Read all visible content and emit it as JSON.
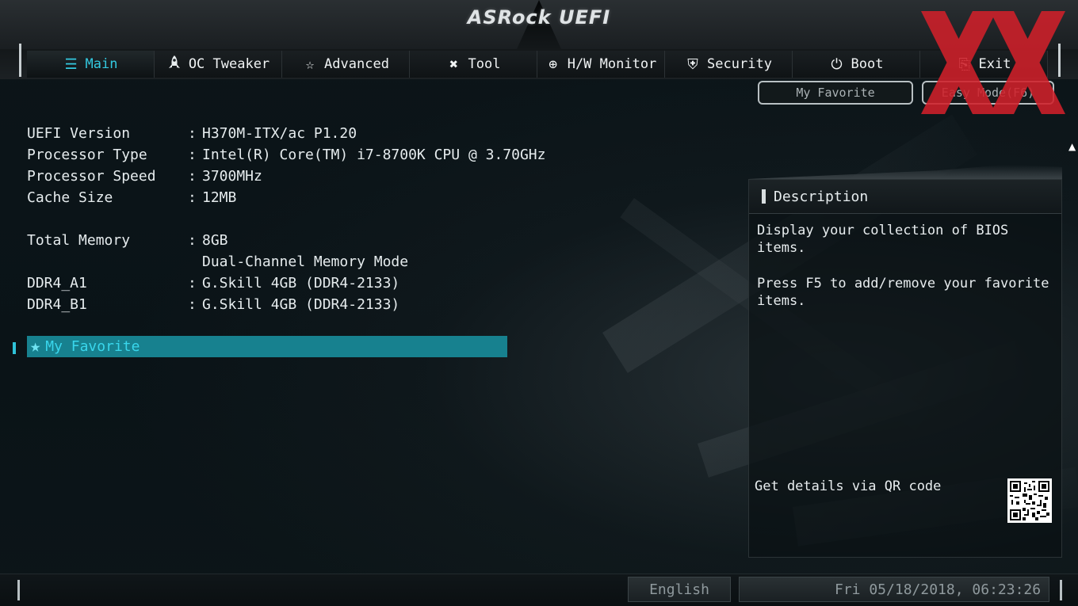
{
  "app": {
    "logo": "ASRock UEFI"
  },
  "tabs": [
    {
      "label": "Main",
      "icon": "list-icon",
      "glyph": "☰",
      "active": true
    },
    {
      "label": "OC Tweaker",
      "icon": "rocket-icon",
      "glyph": "🚀",
      "active": false
    },
    {
      "label": "Advanced",
      "icon": "star-icon",
      "glyph": "☆",
      "active": false
    },
    {
      "label": "Tool",
      "icon": "tools-icon",
      "glyph": "✖",
      "active": false
    },
    {
      "label": "H/W Monitor",
      "icon": "crosshair-icon",
      "glyph": "⊕",
      "active": false
    },
    {
      "label": "Security",
      "icon": "shield-icon",
      "glyph": "⛨",
      "active": false
    },
    {
      "label": "Boot",
      "icon": "power-icon",
      "glyph": "⏻",
      "active": false
    },
    {
      "label": "Exit",
      "icon": "exit-icon",
      "glyph": "⎘",
      "active": false
    }
  ],
  "top_buttons": {
    "my_favorite": "My Favorite",
    "easy_mode": "Easy Mode(F6)"
  },
  "info": {
    "uefi_version": {
      "label": "UEFI Version",
      "value": "H370M-ITX/ac P1.20"
    },
    "processor_type": {
      "label": "Processor Type",
      "value": "Intel(R) Core(TM) i7-8700K CPU @ 3.70GHz"
    },
    "processor_speed": {
      "label": "Processor Speed",
      "value": "3700MHz"
    },
    "cache_size": {
      "label": "Cache Size",
      "value": "12MB"
    },
    "total_memory": {
      "label": "Total Memory",
      "value": "8GB"
    },
    "memory_mode": "Dual-Channel Memory Mode",
    "ddr4_a1": {
      "label": "DDR4_A1",
      "value": "G.Skill 4GB (DDR4-2133)"
    },
    "ddr4_b1": {
      "label": "DDR4_B1",
      "value": "G.Skill 4GB (DDR4-2133)"
    },
    "separator": ":"
  },
  "favorite_item": {
    "label": "My Favorite",
    "icon": "star-icon"
  },
  "description": {
    "title": "Description",
    "line1": "Display your collection of BIOS items.",
    "line2": "Press F5 to add/remove your favorite items.",
    "qr_label": "Get details via QR code"
  },
  "footer": {
    "language": "English",
    "datetime": "Fri 05/18/2018, 06:23:26"
  },
  "colors": {
    "accent": "#33c9e0",
    "highlight_bar": "#17818f",
    "watermark": "#d0202a"
  }
}
